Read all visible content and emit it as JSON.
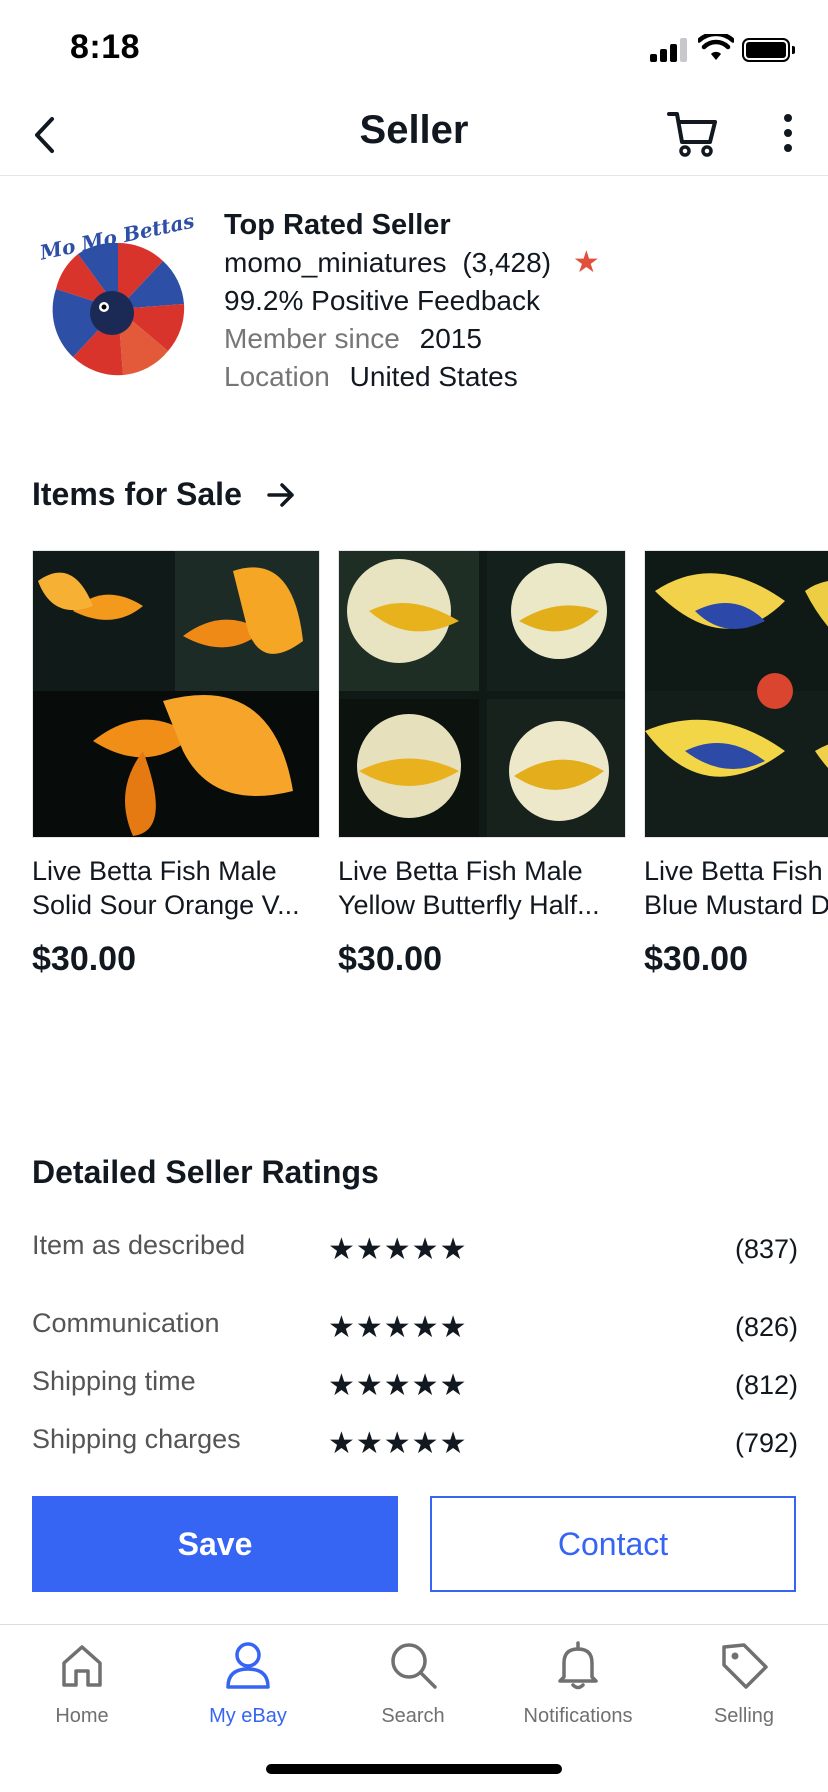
{
  "status_bar": {
    "time": "8:18"
  },
  "header": {
    "title": "Seller",
    "back_icon": "chevron-left-icon",
    "cart_icon": "cart-icon",
    "more_icon": "more-vertical-icon"
  },
  "seller": {
    "badge": "Top Rated Seller",
    "username": "momo_miniatures",
    "feedback_count": "(3,428)",
    "star": "★",
    "positive_feedback": "99.2% Positive Feedback",
    "member_since_label": "Member since",
    "member_since_value": "2015",
    "location_label": "Location",
    "location_value": "United States",
    "logo_text": "Mo Mo Bettas"
  },
  "items_for_sale": {
    "title": "Items for Sale",
    "items": [
      {
        "line1": "Live Betta Fish Male",
        "line2": "Solid Sour Orange V...",
        "price": "$30.00"
      },
      {
        "line1": "Live Betta Fish Male",
        "line2": "Yellow Butterfly Half...",
        "price": "$30.00"
      },
      {
        "line1": "Live Betta Fish",
        "line2": "Blue Mustard D",
        "price": "$30.00"
      }
    ]
  },
  "ratings": {
    "title": "Detailed Seller Ratings",
    "rows": [
      {
        "label": "Item as described",
        "stars": "★★★★★",
        "count": "(837)",
        "value": 5
      },
      {
        "label": "Communication",
        "stars": "★★★★★",
        "count": "(826)",
        "value": 5
      },
      {
        "label": "Shipping time",
        "stars": "★★★★★",
        "count": "(812)",
        "value": 5
      },
      {
        "label": "Shipping charges",
        "stars": "★★★★★",
        "count": "(792)",
        "value": 5
      }
    ]
  },
  "actions": {
    "save": "Save",
    "contact": "Contact"
  },
  "tabbar": {
    "tabs": [
      {
        "label": "Home",
        "icon": "home-icon"
      },
      {
        "label": "My eBay",
        "icon": "person-icon",
        "active": true
      },
      {
        "label": "Search",
        "icon": "search-icon"
      },
      {
        "label": "Notifications",
        "icon": "bell-icon"
      },
      {
        "label": "Selling",
        "icon": "tag-icon"
      }
    ]
  },
  "colors": {
    "accent": "#3665f3",
    "text": "#111820",
    "muted": "#767676",
    "star_red": "#e0503a"
  }
}
